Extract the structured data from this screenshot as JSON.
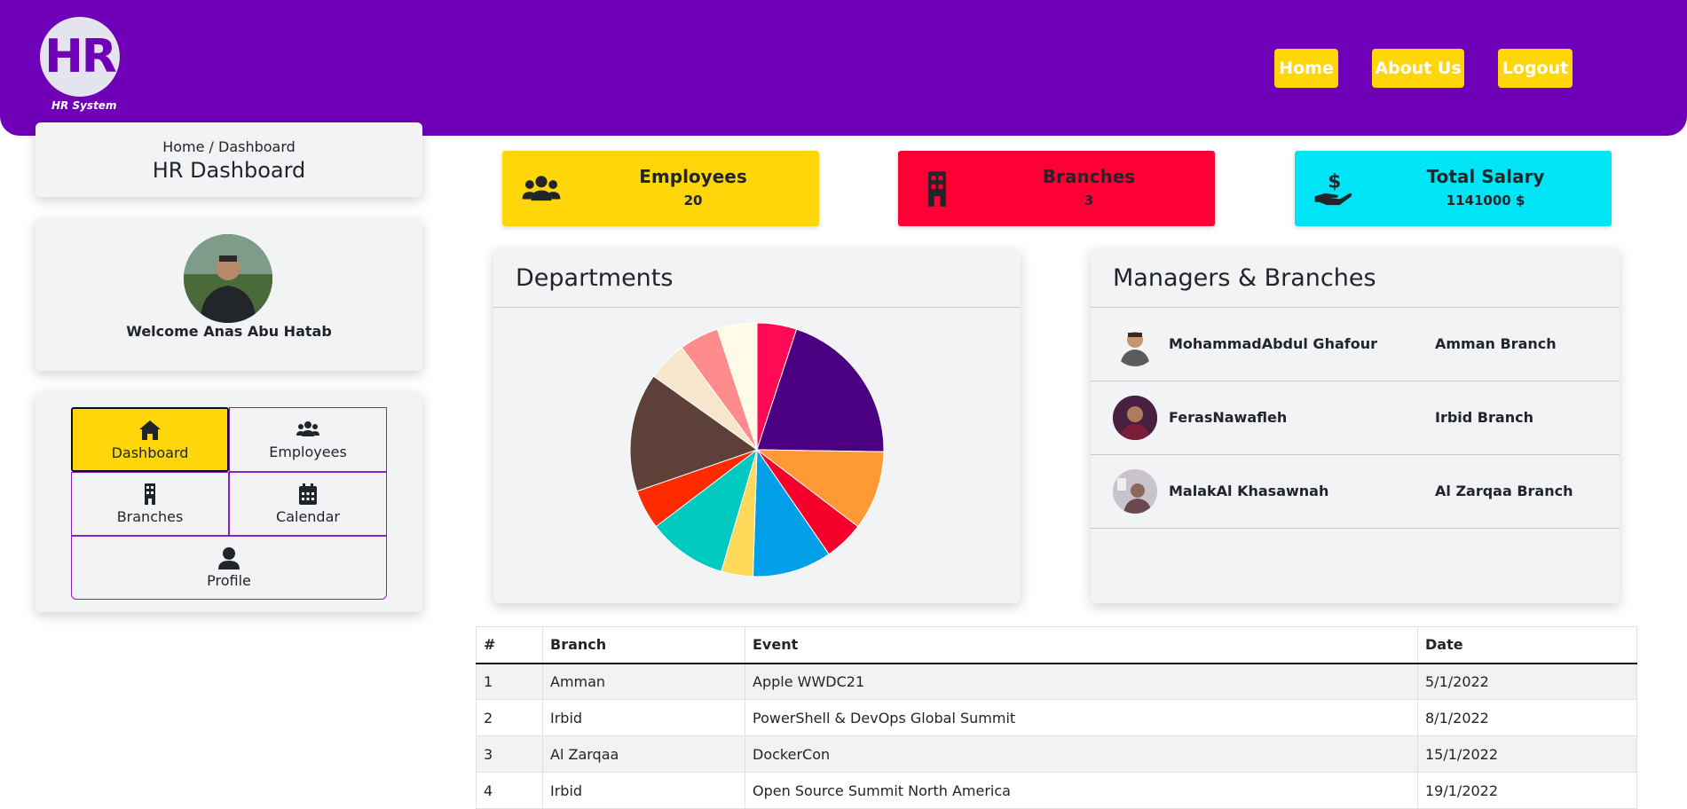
{
  "header": {
    "logo_text": "HR",
    "logo_subtitle": "HR System",
    "nav": [
      "Home",
      "About Us",
      "Logout"
    ]
  },
  "sidebar": {
    "breadcrumb": "Home / Dashboard",
    "title": "HR Dashboard",
    "welcome": "Welcome Anas Abu Hatab",
    "menu": [
      {
        "label": "Dashboard",
        "icon": "home-icon",
        "active": true
      },
      {
        "label": "Employees",
        "icon": "users-icon",
        "active": false
      },
      {
        "label": "Branches",
        "icon": "building-icon",
        "active": false
      },
      {
        "label": "Calendar",
        "icon": "calendar-icon",
        "active": false
      },
      {
        "label": "Profile",
        "icon": "user-icon",
        "active": false
      }
    ]
  },
  "stats": [
    {
      "title": "Employees",
      "value": "20",
      "icon": "users-icon",
      "color": "#ffd60a"
    },
    {
      "title": "Branches",
      "value": "3",
      "icon": "building-icon",
      "color": "#ff0036"
    },
    {
      "title": "Total Salary",
      "value": "1141000 $",
      "icon": "hand-dollar-icon",
      "color": "#00e5f5"
    }
  ],
  "departments": {
    "title": "Departments"
  },
  "chart_data": {
    "type": "pie",
    "values": [
      5,
      20,
      10,
      5,
      10,
      4,
      10,
      5,
      15,
      5,
      5,
      5
    ],
    "colors": [
      "#ff0a54",
      "#4b0082",
      "#ff9933",
      "#f5002a",
      "#009fe8",
      "#ffd95a",
      "#00c9c0",
      "#ff2a00",
      "#5d4037",
      "#f5e6cc",
      "#ff8c8c",
      "#fffbe6"
    ]
  },
  "managers": {
    "title": "Managers & Branches",
    "rows": [
      {
        "name": "MohammadAbdul Ghafour",
        "branch": "Amman Branch"
      },
      {
        "name": "FerasNawafleh",
        "branch": "Irbid Branch"
      },
      {
        "name": "MalakAl Khasawnah",
        "branch": "Al Zarqaa Branch"
      }
    ]
  },
  "events": {
    "headers": [
      "#",
      "Branch",
      "Event",
      "Date"
    ],
    "rows": [
      [
        "1",
        "Amman",
        "Apple WWDC21",
        "5/1/2022"
      ],
      [
        "2",
        "Irbid",
        "PowerShell & DevOps Global Summit",
        "8/1/2022"
      ],
      [
        "3",
        "Al Zarqaa",
        "DockerCon",
        "15/1/2022"
      ],
      [
        "4",
        "Irbid",
        "Open Source Summit North America",
        "19/1/2022"
      ]
    ]
  }
}
